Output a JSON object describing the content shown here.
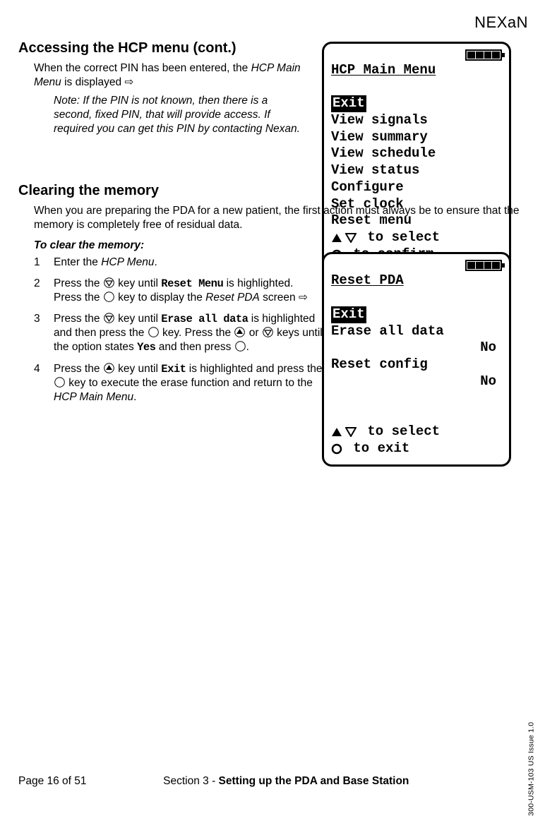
{
  "brand": "NEXaN",
  "section1": {
    "title": "Accessing the HCP menu (cont.)",
    "para_prefix": "When the correct PIN has been entered, the ",
    "para_italic": "HCP Main Menu",
    "para_suffix": " is displayed ",
    "arrow": "⇨",
    "note": "Note: If the PIN is not known, then there is a second, fixed PIN, that will provide access. If required you can get this PIN by contacting Nexan."
  },
  "lcd1": {
    "title": "HCP Main Menu",
    "items": [
      "Exit",
      "View signals",
      "View summary",
      "View schedule",
      "View status",
      "Configure",
      "Set clock",
      "Reset menu"
    ],
    "help1_text": " to select",
    "help2_text": " to confirm"
  },
  "section2": {
    "title": "Clearing the memory",
    "intro": "When you are preparing the PDA for a new patient, the first action must always be to ensure that the memory is completely free of residual data.",
    "subhead": "To clear the memory:",
    "steps": [
      {
        "num": "1",
        "a": "Enter the ",
        "it": "HCP Menu",
        "b": "."
      },
      {
        "num": "2",
        "a": "Press the ",
        "b": " key until ",
        "mono1": "Reset Menu",
        "c": " is highlighted. Press the ",
        "d": " key to display the ",
        "it": "Reset PDA",
        "e": " screen ",
        "arrow": "⇨"
      },
      {
        "num": "3",
        "a": "Press the ",
        "b": " key until ",
        "mono1": "Erase all data",
        "c": " is highlighted and then press the ",
        "d": " key. Press the ",
        "e": " or ",
        "f": " keys until the option states ",
        "mono2": "Yes",
        "g": " and then press ",
        "h": "."
      },
      {
        "num": "4",
        "a": "Press the ",
        "b": " key until ",
        "mono1": "Exit",
        "c": " is highlighted and press the ",
        "d": " key to execute the erase function and return to the ",
        "it": "HCP Main Menu",
        "e": "."
      }
    ]
  },
  "lcd2": {
    "title": "Reset PDA",
    "row_exit": "Exit",
    "row_erase": "Erase all data",
    "row_erase_val": "No",
    "row_reset": "Reset config",
    "row_reset_val": "No",
    "help1_text": " to select",
    "help2_text": " to exit"
  },
  "footer": {
    "page": "Page 16 of 51",
    "section_prefix": "Section 3 - ",
    "section_bold": "Setting up the PDA and Base Station"
  },
  "side_label": "300-USM-103 US Issue 1.0"
}
